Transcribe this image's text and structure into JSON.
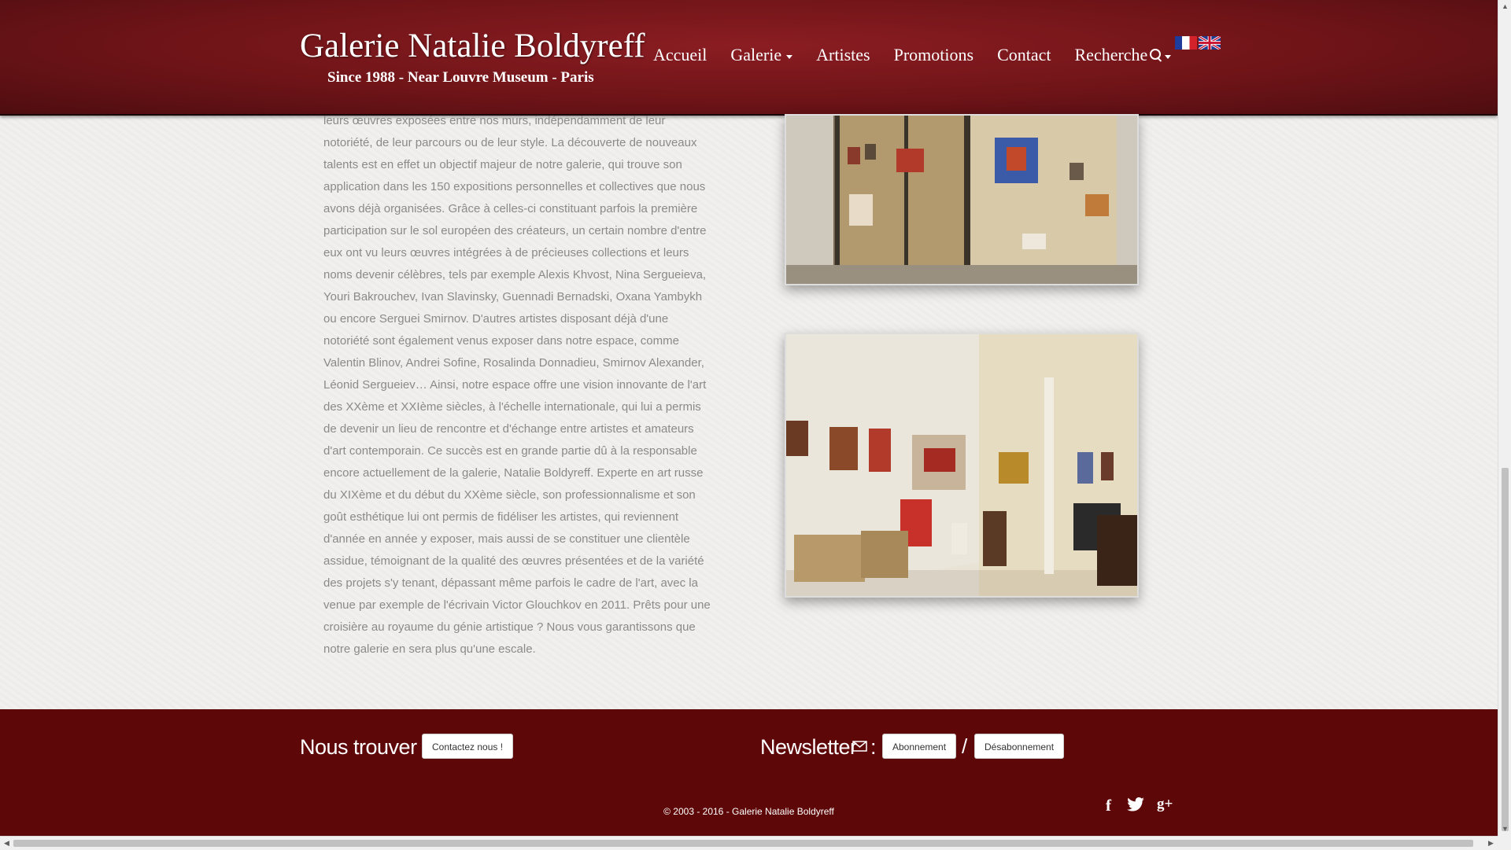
{
  "header": {
    "brand": "Galerie Natalie Boldyreff",
    "tagline": "Since 1988 - Near Louvre Museum - Paris",
    "nav": {
      "accueil": "Accueil",
      "galerie": "Galerie",
      "artistes": "Artistes",
      "promotions": "Promotions",
      "contact": "Contact",
      "recherche": "Recherche"
    }
  },
  "article": {
    "text": "leurs œuvres exposées entre nos murs, indépendamment de leur notoriété, de leur parcours ou de leur style. La découverte de nouveaux talents est en effet un objectif majeur de notre galerie, qui trouve son application dans les 150 expositions personnelles et collectives que nous avons déjà organisées. Grâce à celles-ci constituant parfois la première participation sur le sol européen des créateurs, un certain nombre d'entre eux ont vu leurs œuvres intégrées à de précieuses collections et leurs noms devenir célèbres, tels par exemple Alexis Khvost, Nina Sergueieva, Youri Bakrouchev, Ivan Slavinsky, Guennadi Bernadski, Oxana Yambykh ou encore Serguei Smirnov. D'autres artistes disposant déjà d'une notoriété sont également venus exposer dans notre espace, comme Valentin Blinov, Andrei Sofine, Rosalinda Donnadieu, Smirnov Alexander, Léonid Sergueiev… Ainsi, notre espace offre une vision innovante de l'art des XXème et XXIème siècles, à l'échelle internationale, qui lui a permis de devenir un lieu de rencontre et d'échange entre artistes et amateurs d'art contemporain. Ce succès est en grande partie dû à la responsable encore actuellement de la galerie, Natalie Boldyreff. Experte en art russe du XIXème et du début du XXème siècle, son professionnalisme et son goût esthétique lui ont permis de fidéliser les artistes, qui reviennent d'année en année y exposer, mais aussi de se constituer une clientèle assidue, témoignant de la qualité des œuvres présentées et de la variété des projets s'y tenant, dépassant même parfois le cadre de l'art, avec la venue par exemple de l'écrivain Victor Glouchkov en 2011. Prêts pour une croisière au royaume du génie artistique ? Nous vous garantissons que notre galerie en sera plus qu'une escale."
  },
  "footer": {
    "find_title": "Nous trouver ?",
    "contact_button": "Contactez nous !",
    "newsletter_title": "Newsletter",
    "newsletter_colon": ":",
    "subscribe_button": "Abonnement",
    "slash": "/",
    "unsubscribe_button": "Désabonnement",
    "copyright": "© 2003 - 2016 - Galerie Natalie Boldyreff",
    "social": {
      "facebook": "f",
      "googleplus": "g+"
    }
  },
  "icons": {
    "search": "search-icon",
    "envelope": "envelope-icon",
    "twitter": "twitter-icon",
    "flag_fr": "flag-fr-icon",
    "flag_uk": "flag-uk-icon"
  },
  "colors": {
    "header_red": "#6f1418",
    "footer_red": "#5e0708",
    "body_text": "#8a8a8a"
  }
}
